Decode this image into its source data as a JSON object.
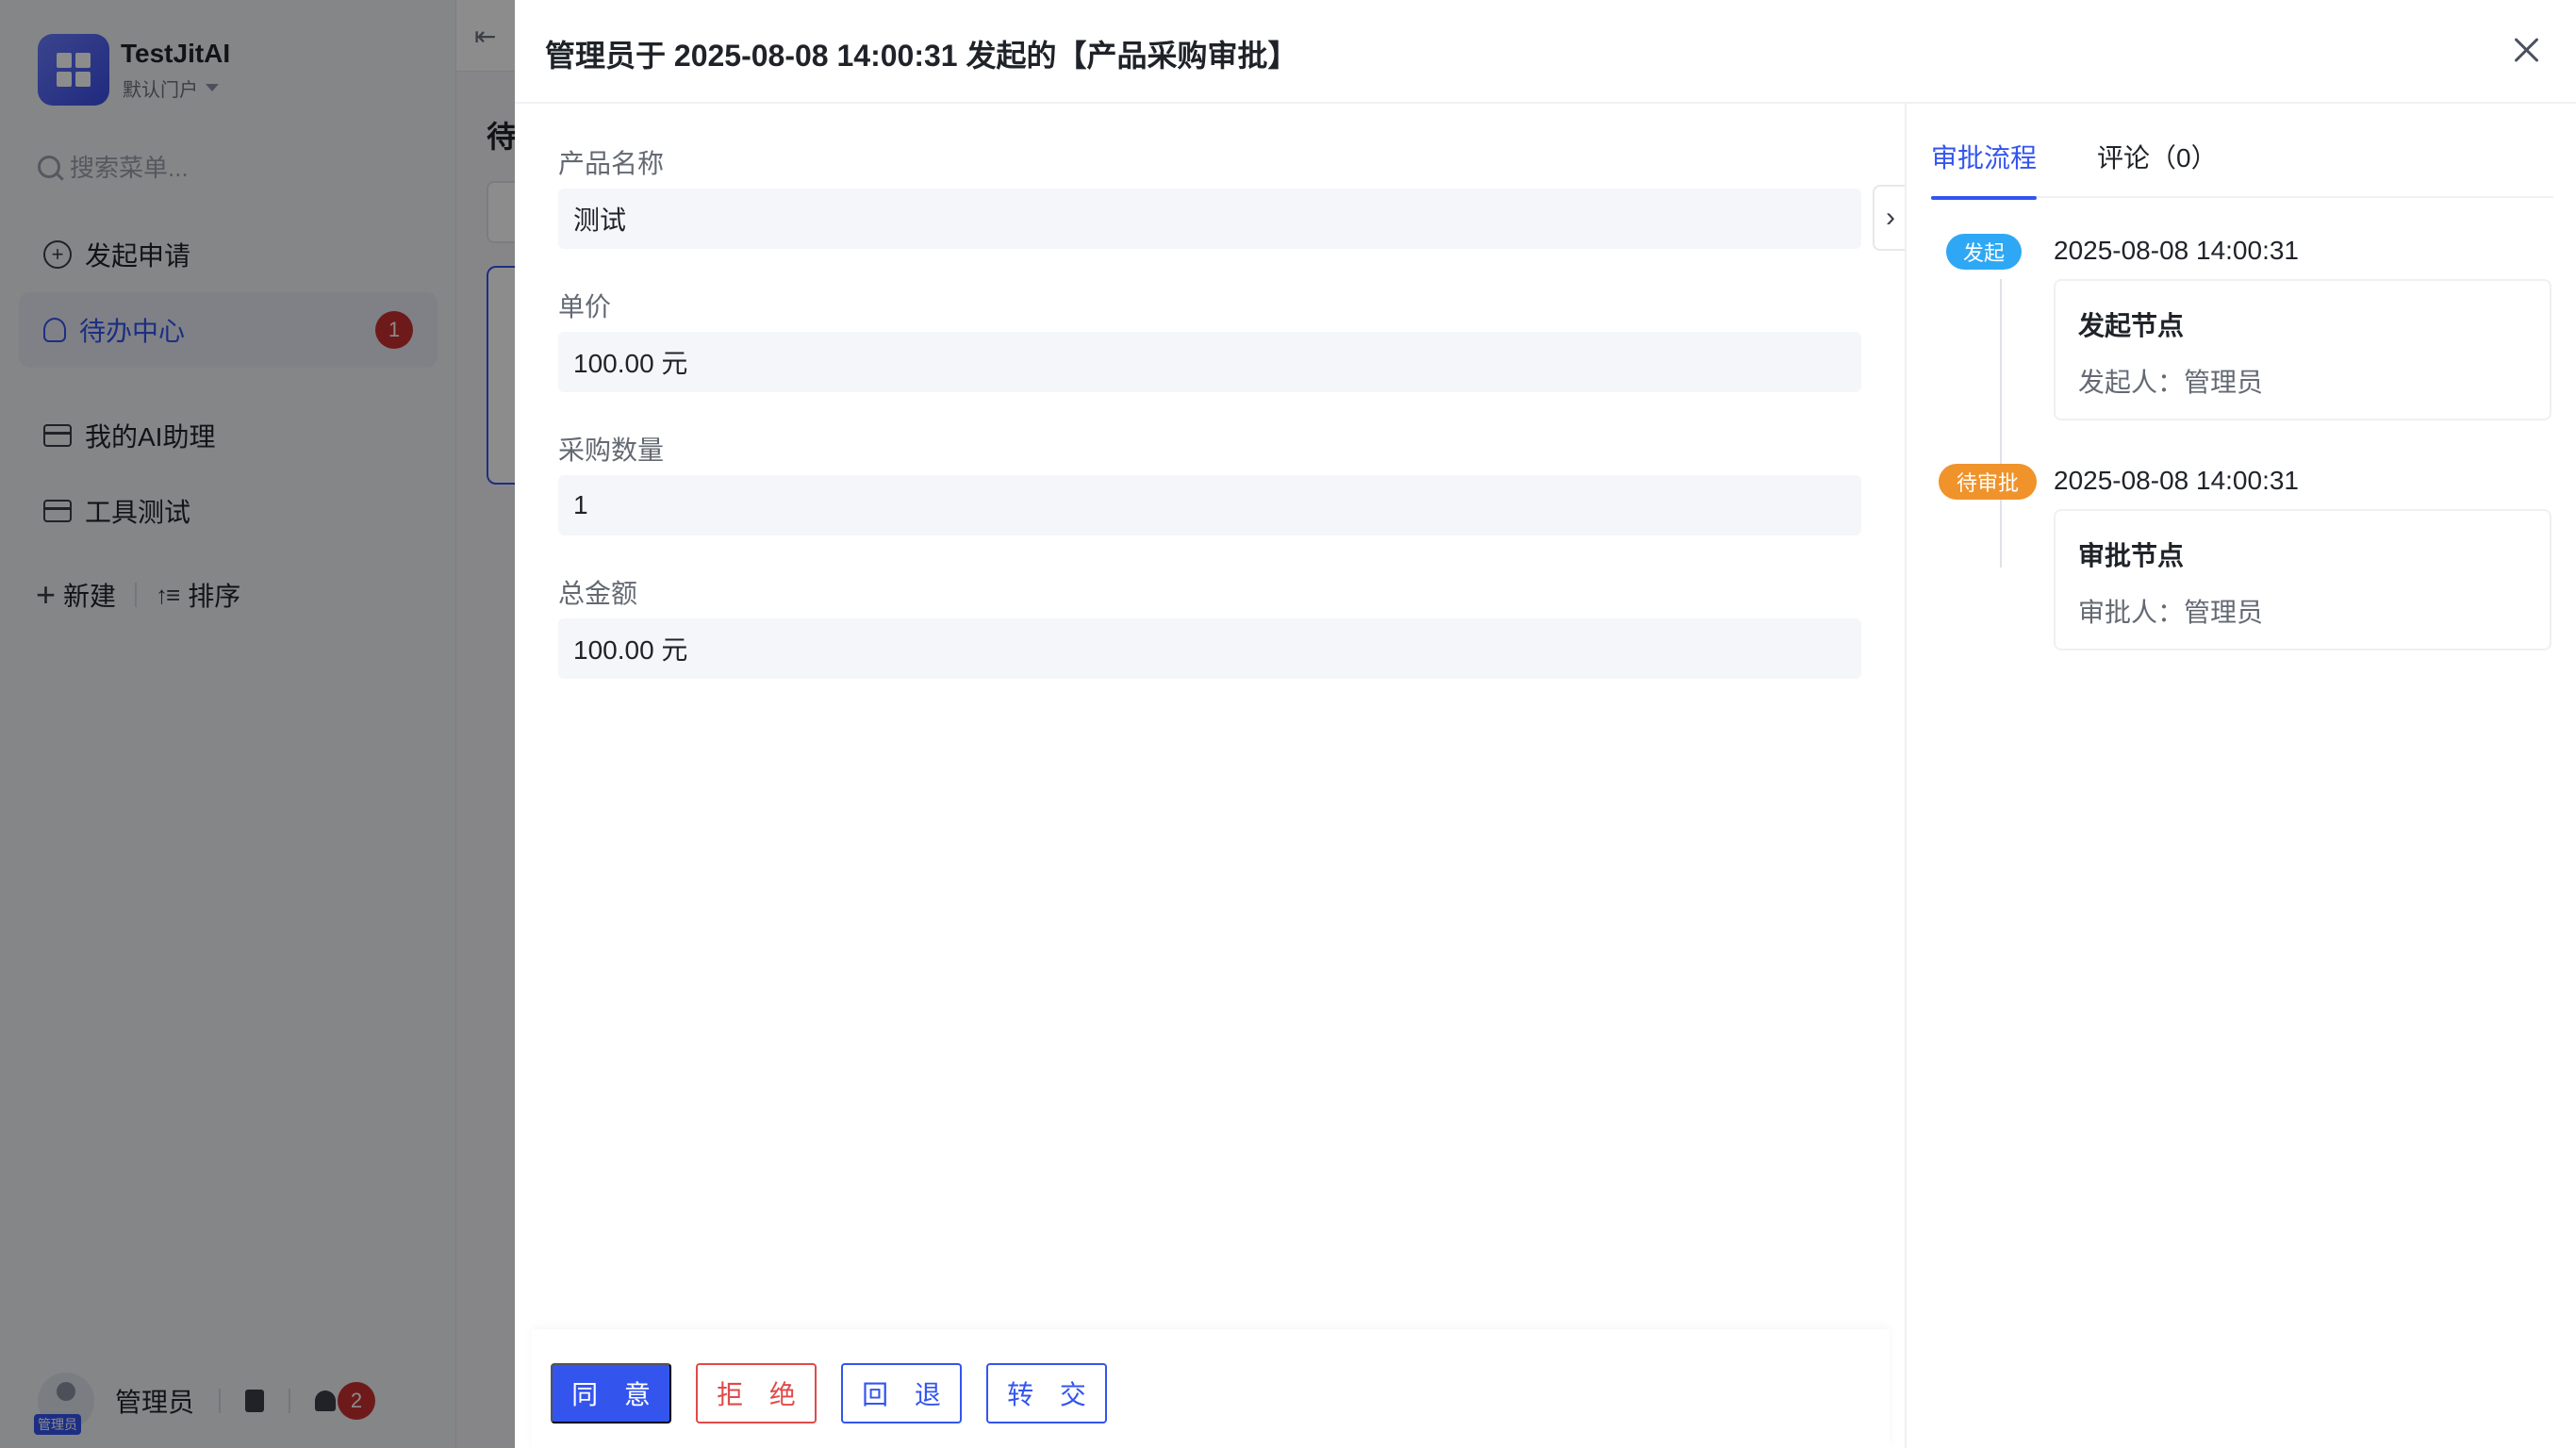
{
  "sidebar": {
    "brand_name": "TestJitAI",
    "portal_label": "默认门户",
    "search_placeholder": "搜索菜单...",
    "items": [
      {
        "label": "发起申请"
      },
      {
        "label": "待办中心",
        "badge": "1"
      },
      {
        "label": "我的AI助理"
      },
      {
        "label": "工具测试"
      }
    ],
    "new_label": "新建",
    "sort_label": "排序",
    "user_name": "管理员",
    "avatar_tag": "管理员",
    "notification_count": "2"
  },
  "main": {
    "page_title_peek": "待"
  },
  "drawer": {
    "title": "管理员于 2025-08-08 14:00:31 发起的【产品采购审批】",
    "fields": [
      {
        "label": "产品名称",
        "value": "测试"
      },
      {
        "label": "单价",
        "value": "100.00 元"
      },
      {
        "label": "采购数量",
        "value": "1"
      },
      {
        "label": "总金额",
        "value": "100.00 元"
      }
    ],
    "actions": {
      "agree": "同 意",
      "reject": "拒 绝",
      "return": "回 退",
      "transfer": "转 交"
    }
  },
  "panel": {
    "tabs": [
      {
        "label": "审批流程",
        "active": true
      },
      {
        "label": "评论（0）",
        "active": false
      }
    ],
    "timeline": [
      {
        "tag": "发起",
        "tag_color": "#2ea8f5",
        "time": "2025-08-08 14:00:31",
        "node_title": "发起节点",
        "person": "发起人：管理员"
      },
      {
        "tag": "待审批",
        "tag_color": "#f0932b",
        "time": "2025-08-08 14:00:31",
        "node_title": "审批节点",
        "person": "审批人：管理员"
      }
    ]
  },
  "colors": {
    "accent": "#3355ee",
    "danger": "#e04a4a",
    "badge": "#c93030"
  }
}
